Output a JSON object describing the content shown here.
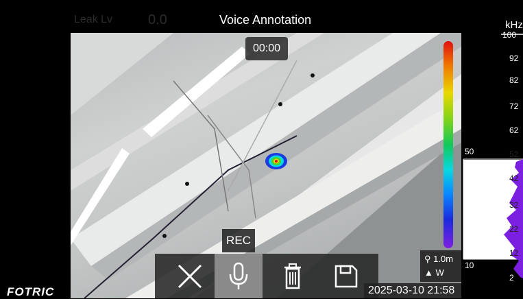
{
  "header": {
    "title": "Voice Annotation",
    "leak_label": "Leak Lv",
    "leak_value": "0.0"
  },
  "recording": {
    "timer": "00:00",
    "rec_label": "REC"
  },
  "toolbar": {
    "buttons": [
      {
        "icon": "close-icon",
        "active": false
      },
      {
        "icon": "microphone-icon",
        "active": true
      },
      {
        "icon": "trash-icon",
        "active": false
      },
      {
        "icon": "save-icon",
        "active": false
      }
    ]
  },
  "info": {
    "distance": "1.0m",
    "direction": "W",
    "datetime": "2025-03-10 21:58",
    "brand": "FOTRIC"
  },
  "spectrum": {
    "unit": "kHz",
    "ticks": [
      "100",
      "92",
      "82",
      "72",
      "62",
      "52",
      "42",
      "32",
      "22",
      "12",
      "2"
    ],
    "threshold_high": "50",
    "threshold_low": "10"
  },
  "colors": {
    "spectrum_fill": "#7b1fe0",
    "active_button": "#8a8a8a",
    "toolbar_bg": "#282828"
  }
}
